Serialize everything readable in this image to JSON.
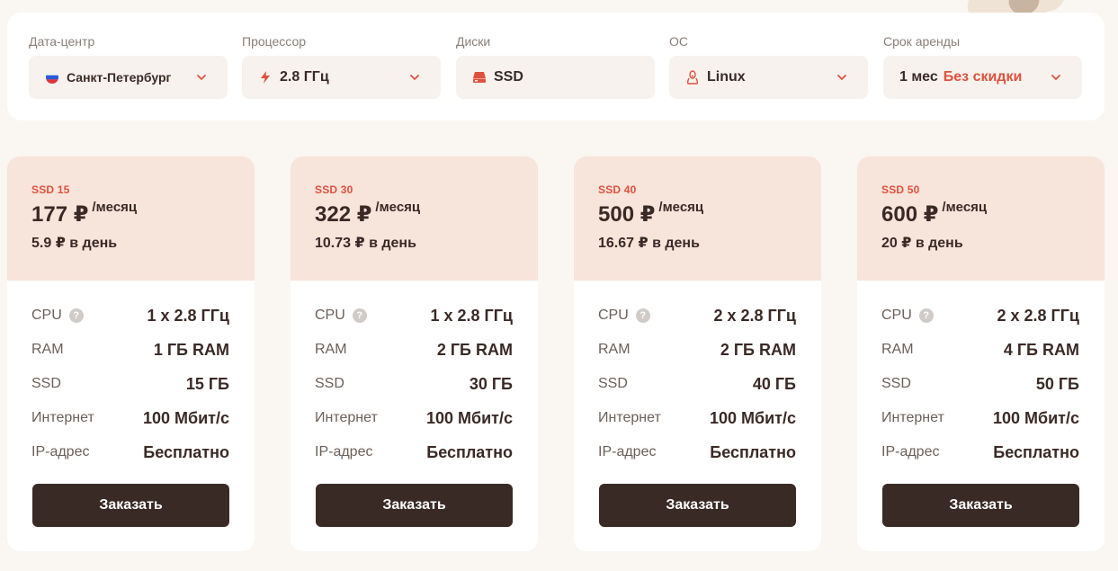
{
  "filters": {
    "datacenter": {
      "label": "Дата-центр",
      "value": "Санкт-Петербург",
      "icon": "russia-flag-icon"
    },
    "cpu": {
      "label": "Процессор",
      "value": "2.8 ГГц",
      "icon": "lightning-icon"
    },
    "disk": {
      "label": "Диски",
      "value": "SSD",
      "icon": "drive-icon"
    },
    "os": {
      "label": "ОС",
      "value": "Linux",
      "icon": "linux-penguin-icon"
    },
    "term": {
      "label": "Срок аренды",
      "value": "1 мес",
      "discount": "Без скидки"
    }
  },
  "spec_labels": {
    "cpu": "CPU",
    "ram": "RAM",
    "ssd": "SSD",
    "internet": "Интернет",
    "ip": "IP-адрес"
  },
  "order_label": "Заказать",
  "per_month": "/месяц",
  "plans": [
    {
      "name": "SSD 15",
      "price": "177 ₽",
      "per_day": "5.9 ₽ в день",
      "cpu": "1 x 2.8 ГГц",
      "ram": "1 ГБ RAM",
      "ssd": "15 ГБ",
      "internet": "100 Мбит/с",
      "ip": "Бесплатно"
    },
    {
      "name": "SSD 30",
      "price": "322 ₽",
      "per_day": "10.73 ₽ в день",
      "cpu": "1 x 2.8 ГГц",
      "ram": "2 ГБ RAM",
      "ssd": "30 ГБ",
      "internet": "100 Мбит/с",
      "ip": "Бесплатно"
    },
    {
      "name": "SSD 40",
      "price": "500 ₽",
      "per_day": "16.67 ₽ в день",
      "cpu": "2 x 2.8 ГГц",
      "ram": "2 ГБ RAM",
      "ssd": "40 ГБ",
      "internet": "100 Мбит/с",
      "ip": "Бесплатно"
    },
    {
      "name": "SSD 50",
      "price": "600 ₽",
      "per_day": "20 ₽ в день",
      "cpu": "2 x 2.8 ГГц",
      "ram": "4 ГБ RAM",
      "ssd": "50 ГБ",
      "internet": "100 Мбит/с",
      "ip": "Бесплатно"
    }
  ],
  "colors": {
    "accent": "#e0513e",
    "button": "#3a2a26",
    "card_header": "#f7e4db",
    "background": "#faf6f1"
  }
}
